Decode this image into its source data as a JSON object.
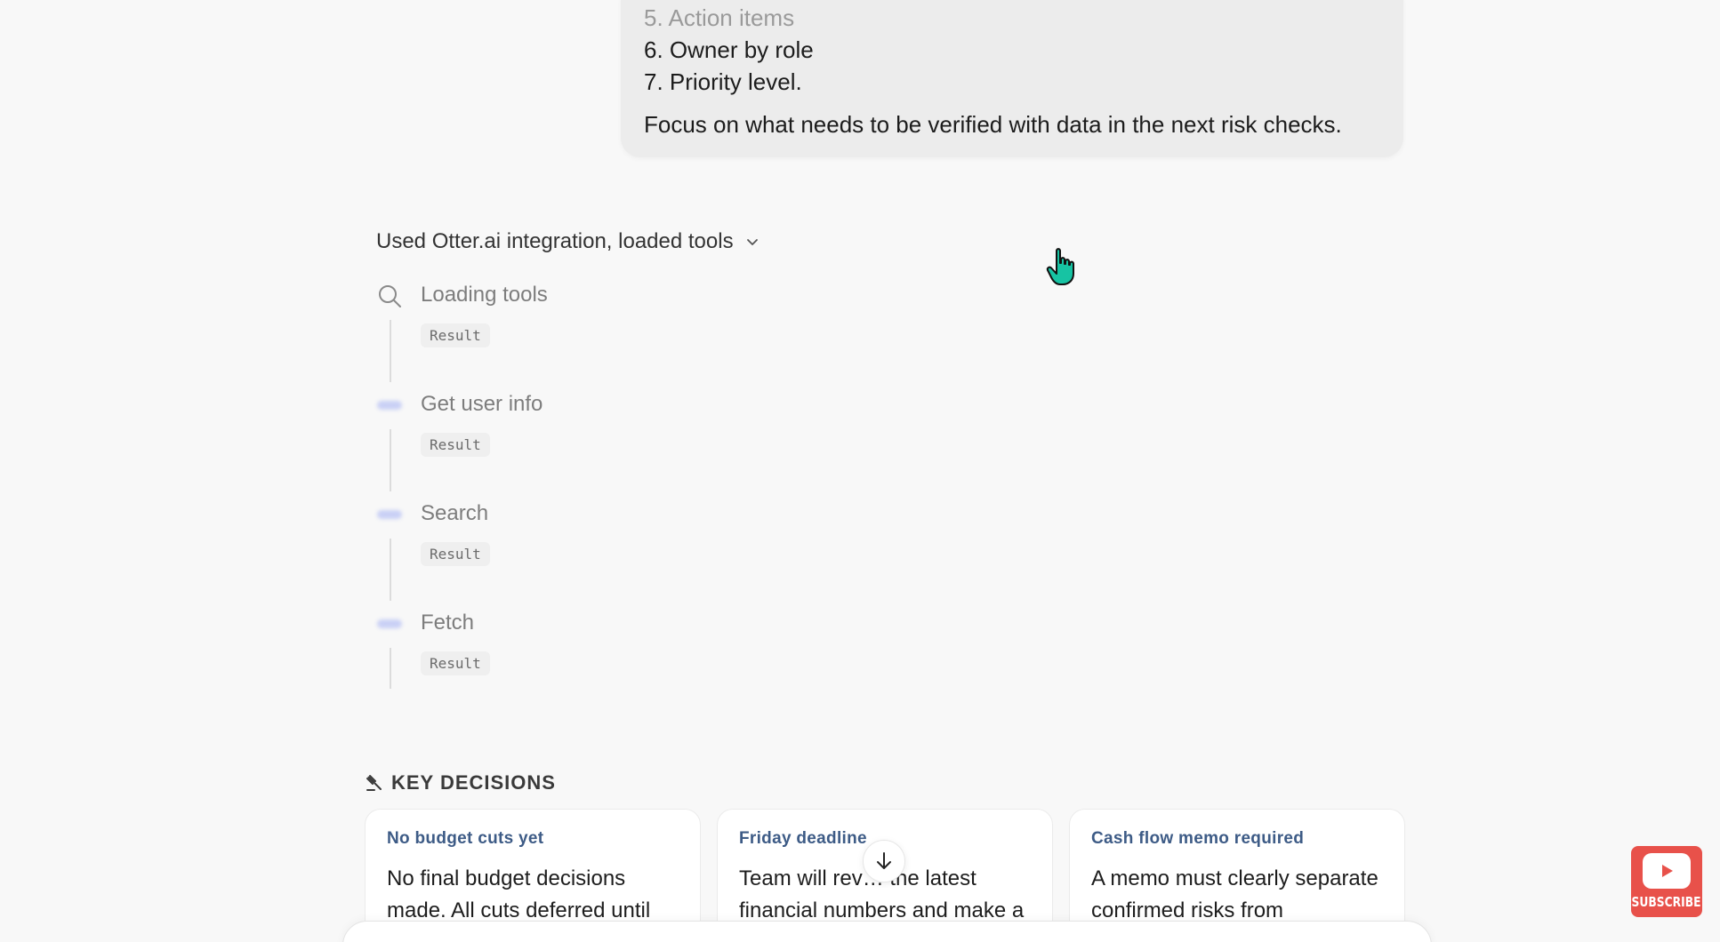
{
  "message": {
    "list_items": [
      "5. Action items",
      "6. Owner by role",
      "7. Priority level."
    ],
    "focus": "Focus on what needs to be verified with data in the next risk checks."
  },
  "tools": {
    "summary": "Used Otter.ai integration, loaded tools",
    "steps": [
      {
        "label": "Loading tools",
        "result": "Result",
        "icon": "search-icon"
      },
      {
        "label": "Get user info",
        "result": "Result",
        "icon": "loading-icon"
      },
      {
        "label": "Search",
        "result": "Result",
        "icon": "loading-icon"
      },
      {
        "label": "Fetch",
        "result": "Result",
        "icon": "loading-icon"
      }
    ]
  },
  "key_decisions": {
    "heading": "KEY DECISIONS",
    "cards": [
      {
        "title": "No budget cuts yet",
        "body": "No final budget decisions made. All cuts deferred until"
      },
      {
        "title": "Friday deadline",
        "body": "Team will rev… the latest financial numbers and make a"
      },
      {
        "title": "Cash flow memo required",
        "body": "A memo must clearly separate confirmed risks from"
      }
    ]
  },
  "subscribe": {
    "label": "SUBSCRIBE"
  },
  "colors": {
    "accent": "#3d5b86",
    "subscribe": "#e8514a",
    "cursor": "#17c3a3"
  }
}
